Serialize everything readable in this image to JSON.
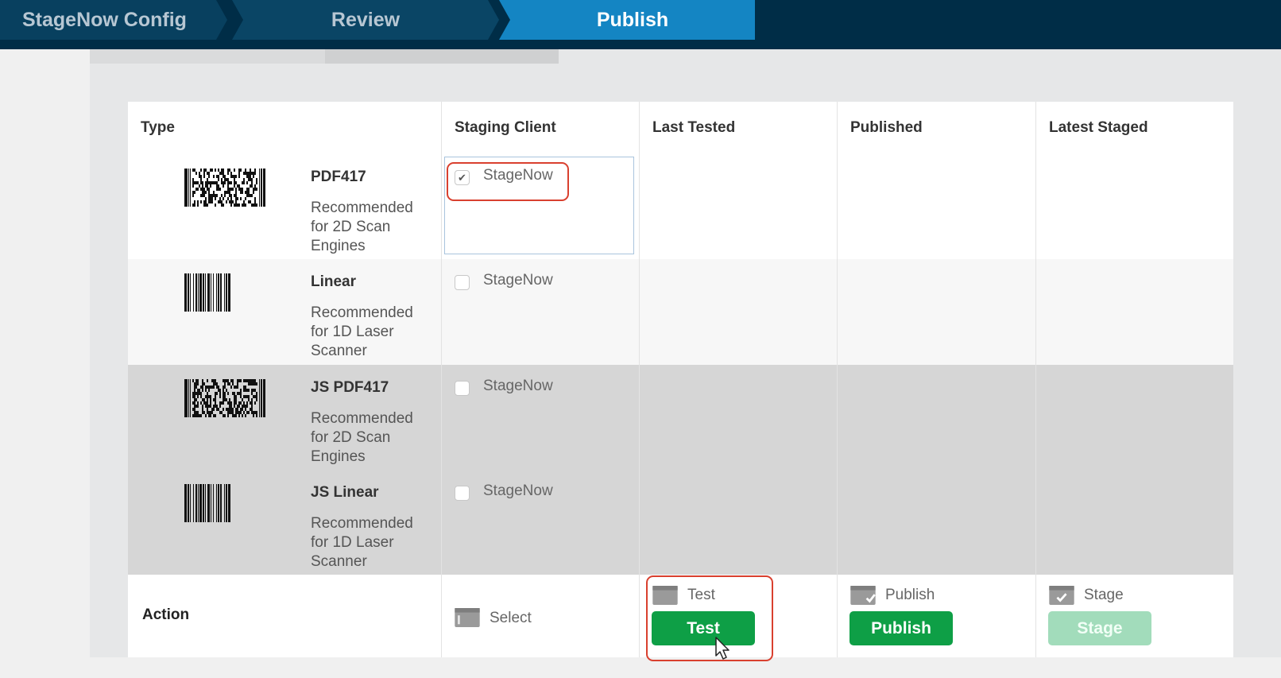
{
  "wizard": {
    "steps": [
      "StageNow Config",
      "Review",
      "Publish"
    ],
    "active_step": "Publish"
  },
  "table": {
    "headers": [
      "Type",
      "Staging Client",
      "Last Tested",
      "Published",
      "Latest Staged"
    ],
    "rows": [
      {
        "type": "PDF417",
        "description": "Recommended for 2D Scan Engines",
        "barcode_kind": "2d",
        "client": "StageNow",
        "checked": true
      },
      {
        "type": "Linear",
        "description": "Recommended for 1D Laser Scanner",
        "barcode_kind": "linear",
        "client": "StageNow",
        "checked": false
      },
      {
        "type": "JS PDF417",
        "description": "Recommended for 2D Scan Engines",
        "barcode_kind": "2d",
        "client": "StageNow",
        "checked": false
      },
      {
        "type": "JS Linear",
        "description": "Recommended for 1D Laser Scanner",
        "barcode_kind": "linear",
        "client": "StageNow",
        "checked": false
      }
    ],
    "action": {
      "label": "Action",
      "select_label": "Select",
      "test_label": "Test",
      "test_button": "Test",
      "publish_label": "Publish",
      "publish_button": "Publish",
      "stage_label": "Stage",
      "stage_button": "Stage",
      "stage_enabled": false
    }
  },
  "colors": {
    "wizard_bg": "#002d47",
    "active_step": "#1485c3",
    "button_green": "#0e9f46",
    "highlight_red": "#d9402f"
  }
}
